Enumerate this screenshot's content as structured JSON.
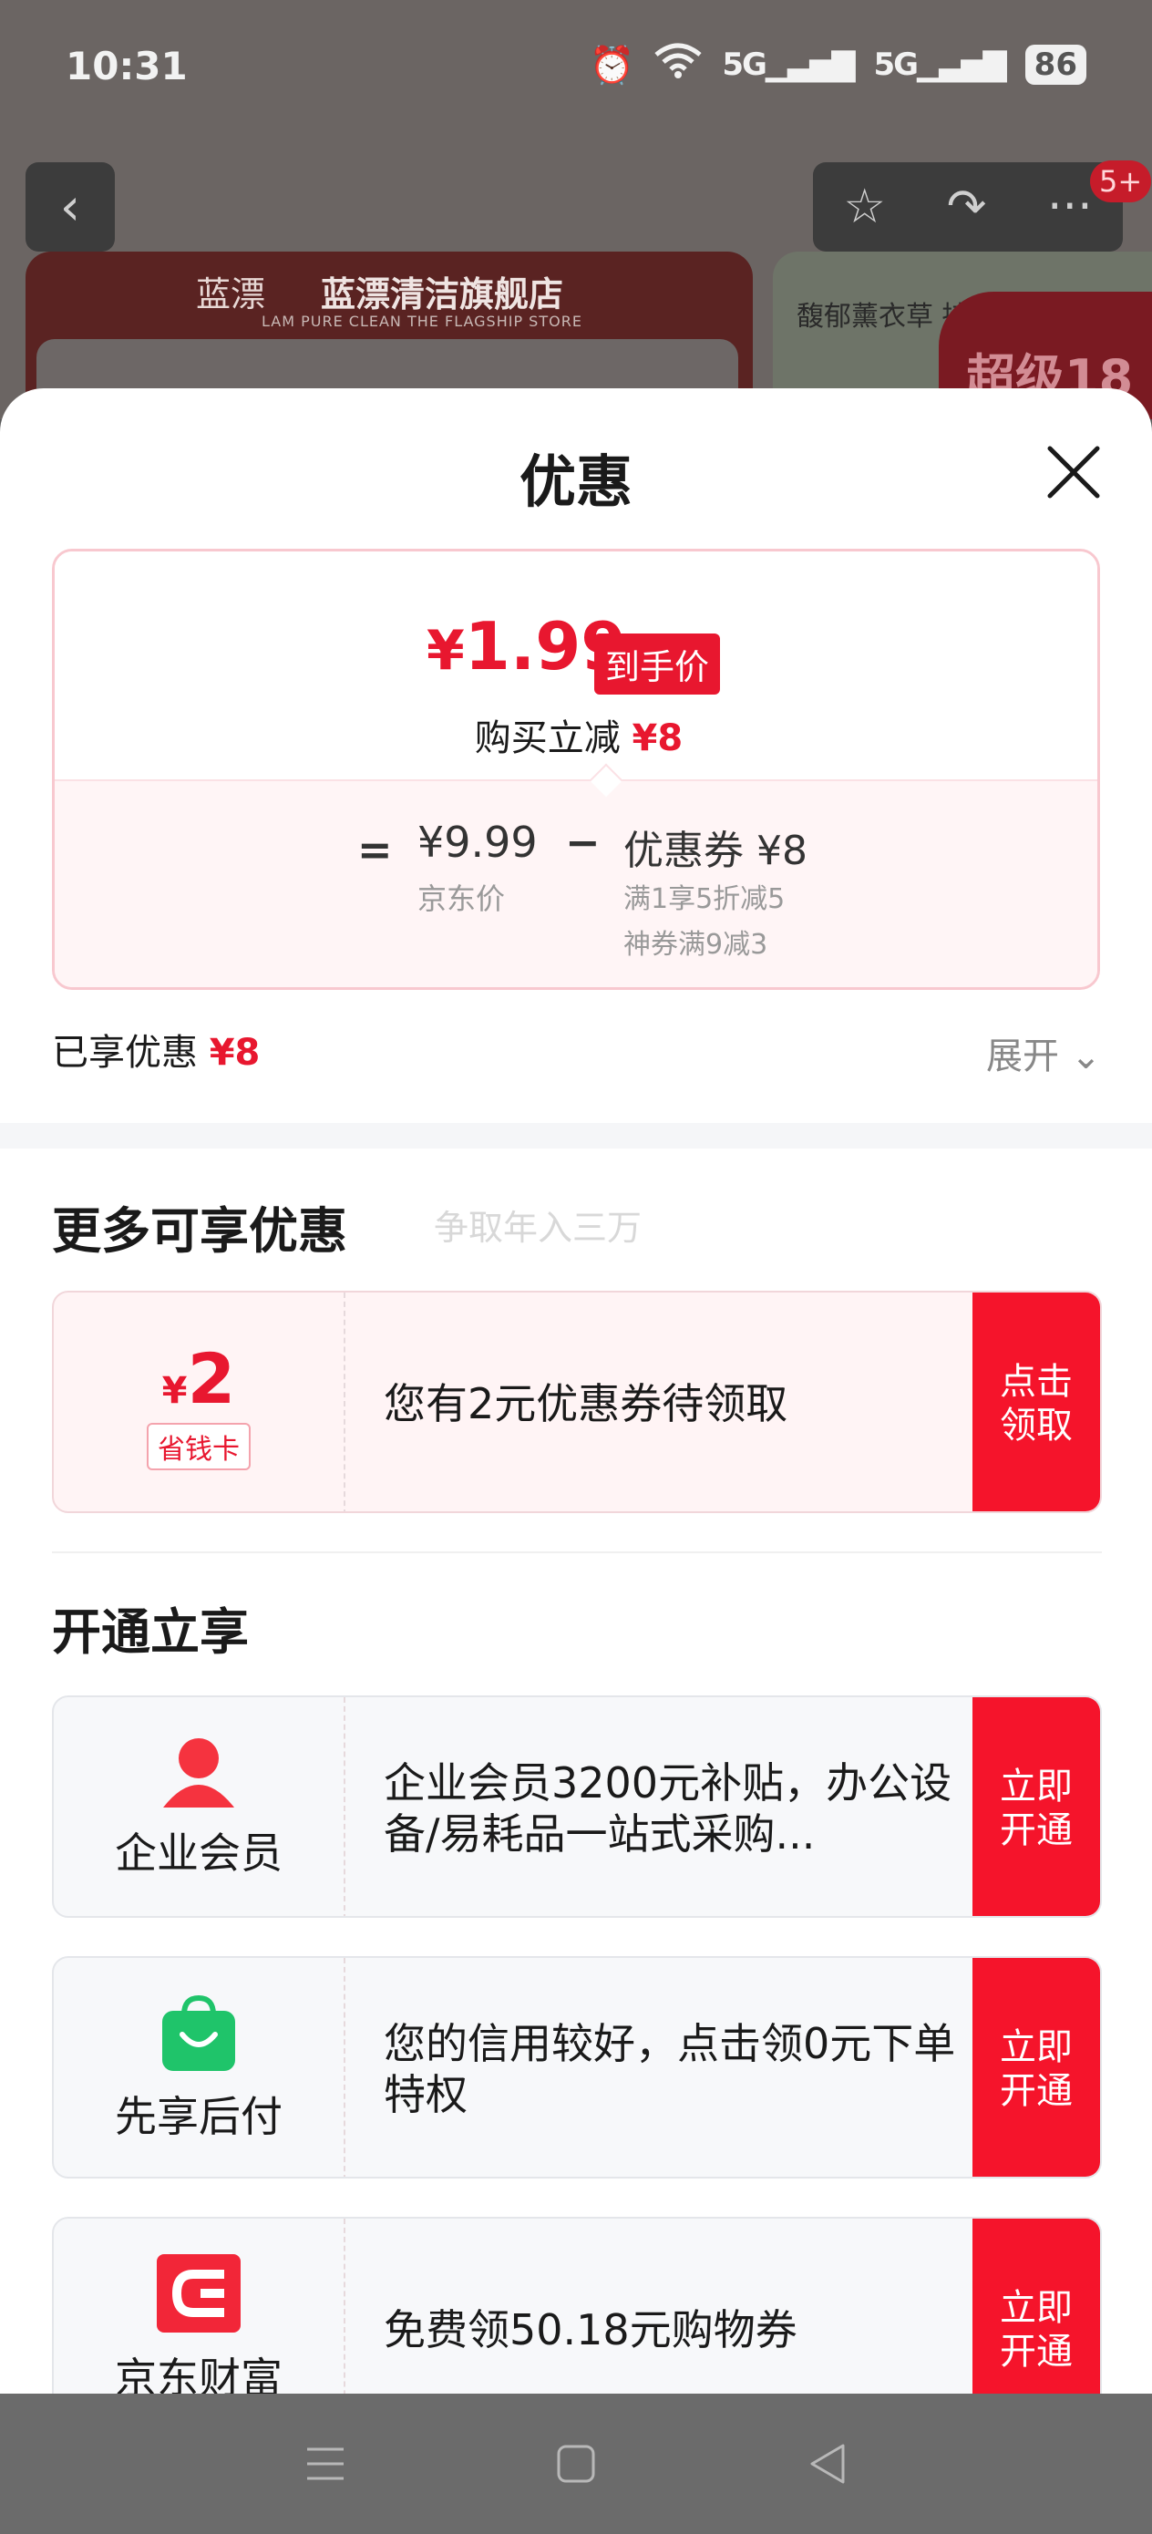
{
  "status_bar": {
    "time": "10:31",
    "signal_1": "5G",
    "signal_2": "5G",
    "battery": "86"
  },
  "background": {
    "badge": "5+",
    "store_logo": "蓝漂",
    "store_name": "蓝漂清洁旗舰店",
    "store_subtitle": "LAM PURE CLEAN THE FLAGSHIP STORE",
    "promo_text": "馥郁薰衣草 持久留",
    "super_tag": "超级18"
  },
  "sheet": {
    "title": "优惠",
    "final_price_symbol": "¥",
    "final_price_value": "1.99",
    "final_price_tag": "到手价",
    "instant_discount_label": "购买立减",
    "instant_discount_value": "¥8",
    "eq": "=",
    "jd_price": "¥9.99",
    "jd_label": "京东价",
    "minus": "−",
    "coupon_amount": "优惠券 ¥8",
    "coupon_rule_1": "满1享5折减5",
    "coupon_rule_2": "神券满9减3",
    "enjoyed_label": "已享优惠",
    "enjoyed_value": "¥8",
    "expand_label": "展开"
  },
  "more_offers": {
    "title": "更多可享优惠",
    "faded_text": "争取年入三万",
    "coupon": {
      "yen": "¥",
      "value": "2",
      "tag": "省钱卡",
      "text": "您有2元优惠券待领取",
      "button": "点击\n领取"
    }
  },
  "open_enjoy": {
    "title": "开通立享",
    "items": [
      {
        "label": "企业会员",
        "icon": "person-icon",
        "icon_color": "#f5333f",
        "text": "企业会员3200元补贴，办公设备/易耗品一站式采购...",
        "button": "立即\n开通"
      },
      {
        "label": "先享后付",
        "icon": "shopping-bag-icon",
        "icon_color": "#1fc46a",
        "text": "您的信用较好，点击领0元下单特权",
        "button": "立即\n开通"
      },
      {
        "label": "京东财富",
        "icon": "jd-finance-icon",
        "icon_color": "#f22638",
        "text": "免费领50.18元购物券",
        "button": "立即\n开通"
      }
    ]
  },
  "colors": {
    "accent_red": "#e8172f",
    "button_red": "#f5142b"
  }
}
